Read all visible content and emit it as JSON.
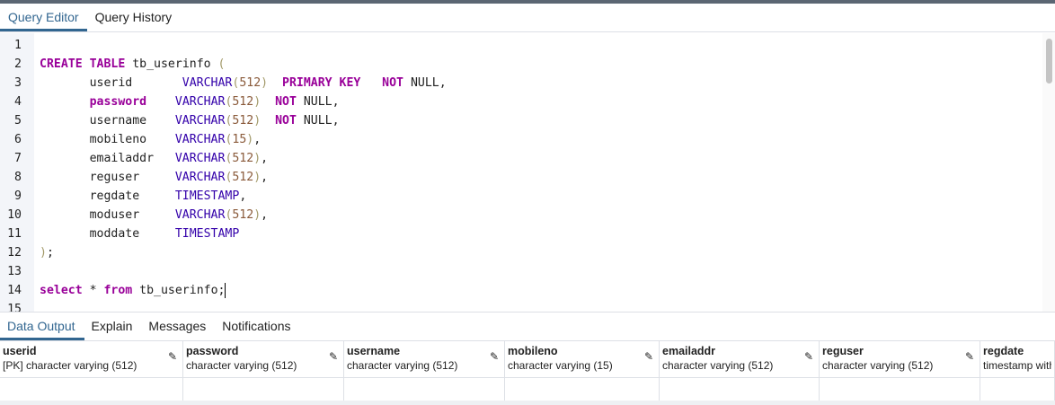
{
  "editor_tabs": [
    "Query Editor",
    "Query History"
  ],
  "code_lines": [
    [],
    [
      [
        "CREATE",
        "kw"
      ],
      [
        " ",
        ""
      ],
      [
        "TABLE",
        "kw"
      ],
      [
        " tb_userinfo ",
        ""
      ],
      [
        "(",
        "pn"
      ]
    ],
    [
      [
        "       userid       ",
        ""
      ],
      [
        "VARCHAR",
        "ty"
      ],
      [
        "(",
        "pn"
      ],
      [
        "512",
        "num"
      ],
      [
        ")",
        "pn"
      ],
      [
        "  ",
        ""
      ],
      [
        "PRIMARY KEY",
        "kw"
      ],
      [
        "   ",
        ""
      ],
      [
        "NOT",
        "kw"
      ],
      [
        " NULL,",
        ""
      ]
    ],
    [
      [
        "       ",
        ""
      ],
      [
        "password",
        "kw"
      ],
      [
        "    ",
        ""
      ],
      [
        "VARCHAR",
        "ty"
      ],
      [
        "(",
        "pn"
      ],
      [
        "512",
        "num"
      ],
      [
        ")",
        "pn"
      ],
      [
        "  ",
        ""
      ],
      [
        "NOT",
        "kw"
      ],
      [
        " NULL,",
        ""
      ]
    ],
    [
      [
        "       username    ",
        ""
      ],
      [
        "VARCHAR",
        "ty"
      ],
      [
        "(",
        "pn"
      ],
      [
        "512",
        "num"
      ],
      [
        ")",
        "pn"
      ],
      [
        "  ",
        ""
      ],
      [
        "NOT",
        "kw"
      ],
      [
        " NULL,",
        ""
      ]
    ],
    [
      [
        "       mobileno    ",
        ""
      ],
      [
        "VARCHAR",
        "ty"
      ],
      [
        "(",
        "pn"
      ],
      [
        "15",
        "num"
      ],
      [
        ")",
        "pn"
      ],
      [
        ",",
        ""
      ]
    ],
    [
      [
        "       emailaddr   ",
        ""
      ],
      [
        "VARCHAR",
        "ty"
      ],
      [
        "(",
        "pn"
      ],
      [
        "512",
        "num"
      ],
      [
        ")",
        "pn"
      ],
      [
        ",",
        ""
      ]
    ],
    [
      [
        "       reguser     ",
        ""
      ],
      [
        "VARCHAR",
        "ty"
      ],
      [
        "(",
        "pn"
      ],
      [
        "512",
        "num"
      ],
      [
        ")",
        "pn"
      ],
      [
        ",",
        ""
      ]
    ],
    [
      [
        "       regdate     ",
        ""
      ],
      [
        "TIMESTAMP",
        "ty"
      ],
      [
        ",",
        ""
      ]
    ],
    [
      [
        "       moduser     ",
        ""
      ],
      [
        "VARCHAR",
        "ty"
      ],
      [
        "(",
        "pn"
      ],
      [
        "512",
        "num"
      ],
      [
        ")",
        "pn"
      ],
      [
        ",",
        ""
      ]
    ],
    [
      [
        "       moddate     ",
        ""
      ],
      [
        "TIMESTAMP",
        "ty"
      ]
    ],
    [
      [
        ")",
        "pn"
      ],
      [
        ";",
        ""
      ]
    ],
    [],
    [
      [
        "select",
        "kw"
      ],
      [
        " * ",
        ""
      ],
      [
        "from",
        "kw"
      ],
      [
        " tb_userinfo;",
        ""
      ]
    ],
    []
  ],
  "cursor_line": 14,
  "output_tabs": [
    "Data Output",
    "Explain",
    "Messages",
    "Notifications"
  ],
  "columns": [
    {
      "name": "userid",
      "type": "[PK] character varying (512)"
    },
    {
      "name": "password",
      "type": "character varying (512)"
    },
    {
      "name": "username",
      "type": "character varying (512)"
    },
    {
      "name": "mobileno",
      "type": "character varying (15)"
    },
    {
      "name": "emailaddr",
      "type": "character varying (512)"
    },
    {
      "name": "reguser",
      "type": "character varying (512)"
    },
    {
      "name": "regdate",
      "type": "timestamp without time zone"
    }
  ]
}
